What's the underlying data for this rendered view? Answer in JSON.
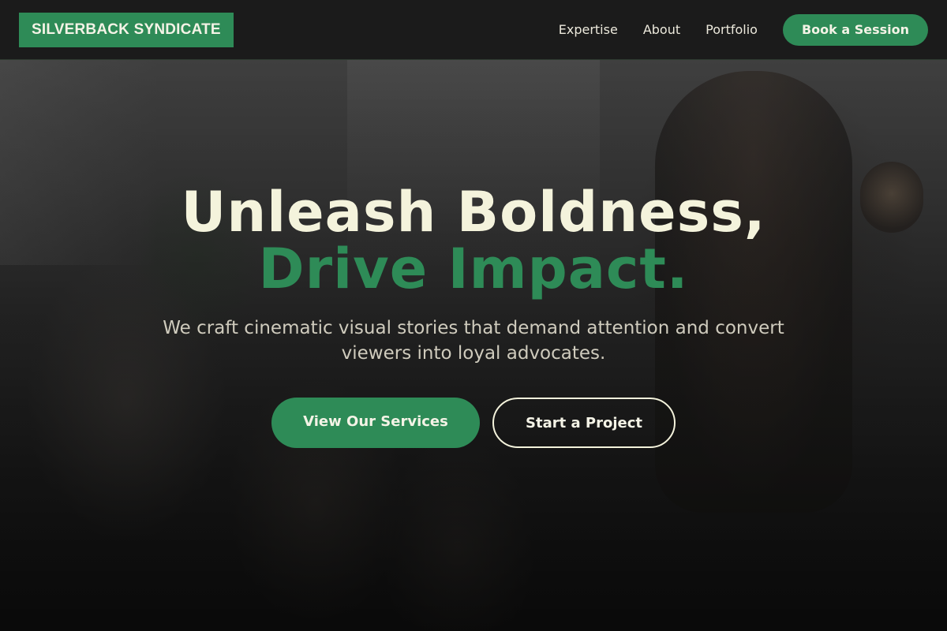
{
  "brand": {
    "name": "SILVERBACK SYNDICATE",
    "accent_color": "#2e8b57",
    "cream_color": "#f4f3dc"
  },
  "nav": {
    "links": [
      {
        "label": "Expertise"
      },
      {
        "label": "About"
      },
      {
        "label": "Portfolio"
      }
    ],
    "cta_label": "Book a Session"
  },
  "hero": {
    "headline_line1": "Unleash Boldness,",
    "headline_line2": "Drive Impact.",
    "subtitle": "We craft cinematic visual stories that demand attention and convert viewers into loyal advocates.",
    "primary_button": "View Our Services",
    "secondary_button": "Start a Project",
    "background_image": "camera-operator-filming-group-photo"
  }
}
